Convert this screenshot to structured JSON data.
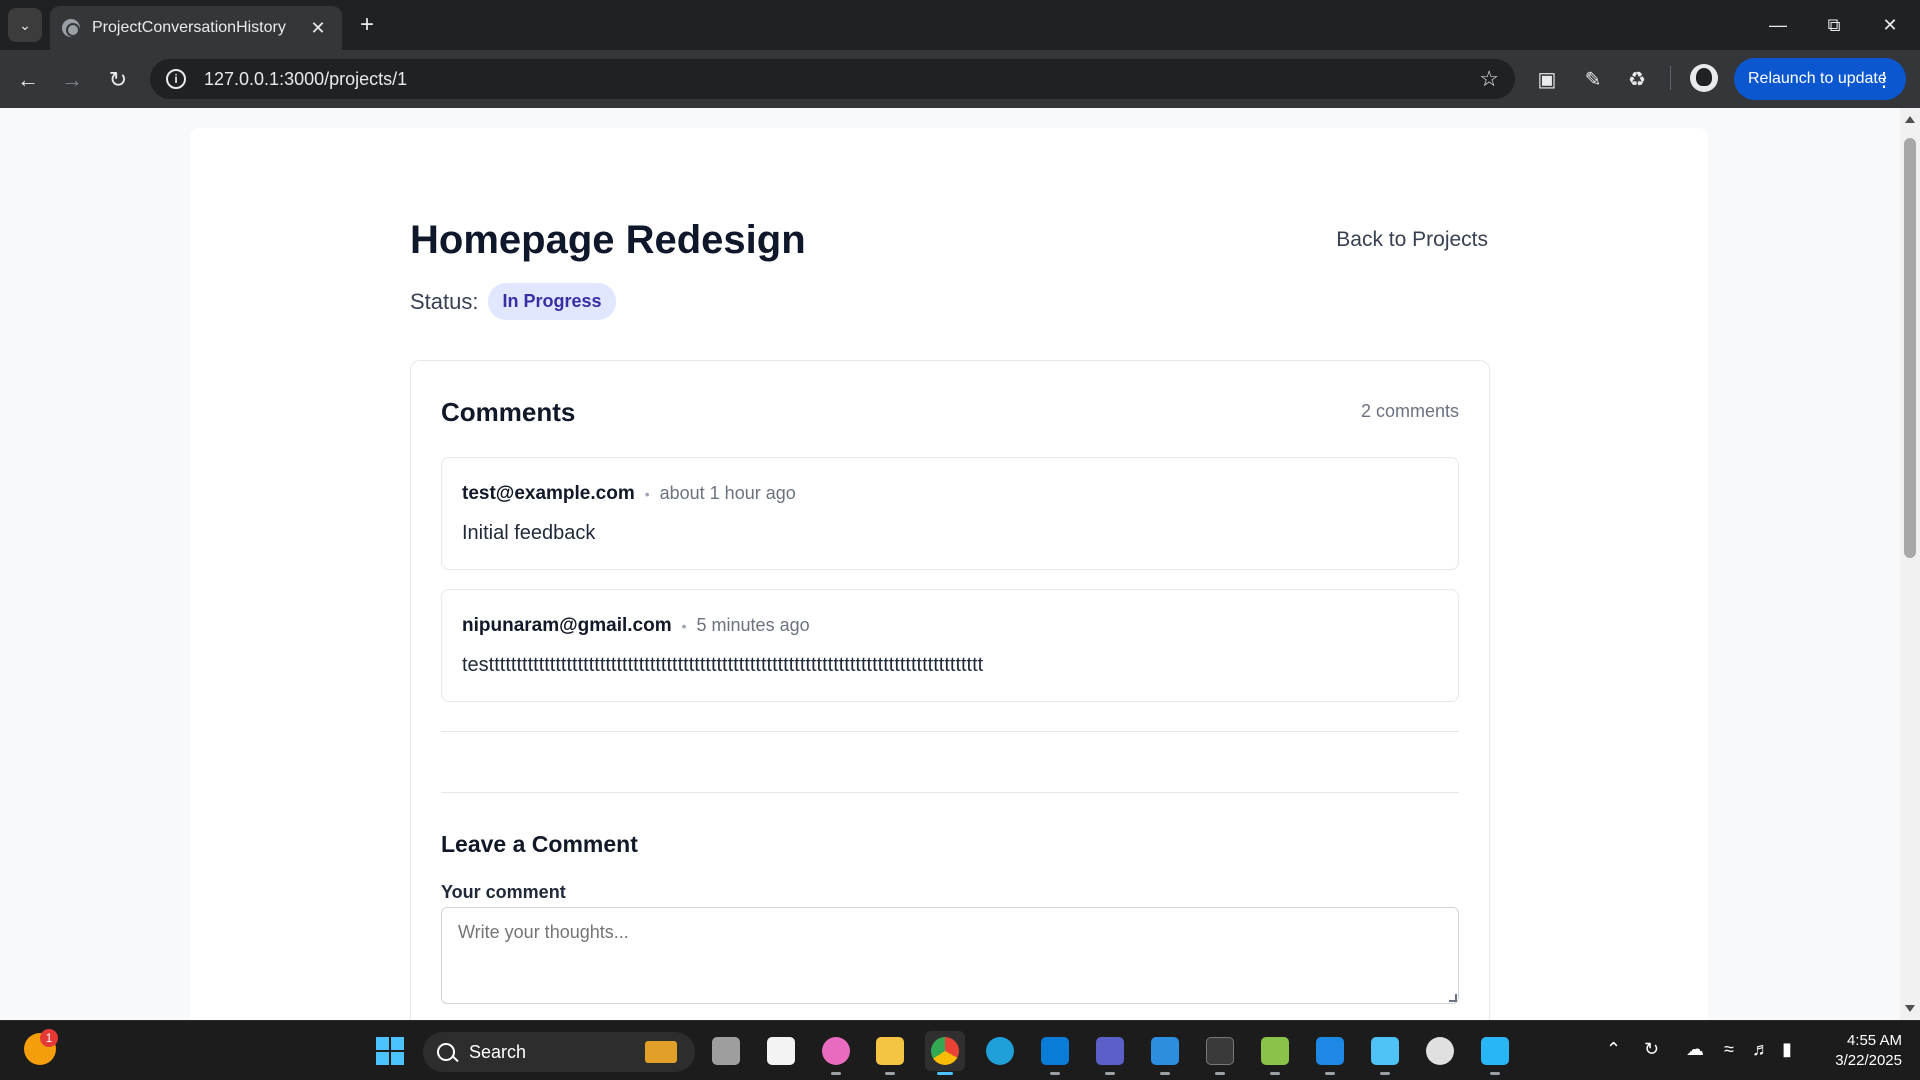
{
  "browser": {
    "tab_title": "ProjectConversationHistory",
    "url": "127.0.0.1:3000/projects/1",
    "relaunch_label": "Relaunch to update"
  },
  "page": {
    "title": "Homepage Redesign",
    "back_link": "Back to Projects",
    "status_label": "Status:",
    "status_value": "In Progress"
  },
  "comments": {
    "heading": "Comments",
    "count": "2 comments",
    "items": [
      {
        "author": "test@example.com",
        "separator": "•",
        "time": "about 1 hour ago",
        "body": "Initial feedback"
      },
      {
        "author": "nipunaram@gmail.com",
        "separator": "•",
        "time": "5 minutes ago",
        "body": "testtttttttttttttttttttttttttttttttttttttttttttttttttttttttttttttttttttttttttttttttttttttttt"
      }
    ]
  },
  "form": {
    "heading": "Leave a Comment",
    "label": "Your comment",
    "placeholder": "Write your thoughts..."
  },
  "taskbar": {
    "search_label": "Search",
    "weather_badge": "1",
    "time": "4:55 AM",
    "date": "3/22/2025",
    "icons": [
      "task-view-icon",
      "store-icon",
      "copilot-icon",
      "file-explorer-icon",
      "chrome-icon",
      "edge-icon",
      "vscode-icon",
      "teams-icon",
      "photos-icon",
      "terminal-icon",
      "notepad-plus-icon",
      "screen-capture-icon",
      "notepad-icon",
      "github-icon",
      "remote-desktop-icon"
    ]
  },
  "colors": {
    "accent": "#4338ca",
    "badge_bg": "#e0e7ff",
    "badge_text": "#3730a3",
    "relaunch": "#0b57d0"
  }
}
